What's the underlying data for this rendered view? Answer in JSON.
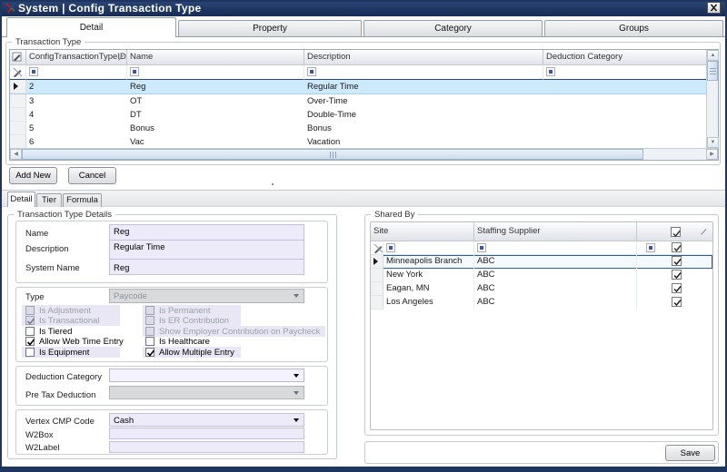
{
  "window": {
    "title": "System | Config Transaction Type"
  },
  "colors": {
    "titlebar": "#1e355f",
    "selection": "#cde9fc",
    "field_lavender": "#edebfa",
    "stripe_lavender": "#e9e7f5"
  },
  "tabs": [
    {
      "label": "Detail",
      "active": true
    },
    {
      "label": "Property",
      "active": false
    },
    {
      "label": "Category",
      "active": false
    },
    {
      "label": "Groups",
      "active": false
    }
  ],
  "transaction_type": {
    "group_label": "Transaction Type",
    "columns": [
      "ConfigTransactionTypeID",
      "Name",
      "Description",
      "Deduction Category"
    ],
    "rows": [
      {
        "id": "2",
        "name": "Reg",
        "description": "Regular Time",
        "deduction_category": "",
        "selected": true
      },
      {
        "id": "3",
        "name": "OT",
        "description": "Over-Time",
        "deduction_category": "",
        "selected": false
      },
      {
        "id": "4",
        "name": "DT",
        "description": "Double-Time",
        "deduction_category": "",
        "selected": false
      },
      {
        "id": "5",
        "name": "Bonus",
        "description": "Bonus",
        "deduction_category": "",
        "selected": false
      },
      {
        "id": "6",
        "name": "Vac",
        "description": "Vacation",
        "deduction_category": "",
        "selected": false
      }
    ]
  },
  "buttons": {
    "add_new": "Add New",
    "cancel": "Cancel",
    "save": "Save"
  },
  "subtabs": [
    {
      "label": "Detail",
      "active": true
    },
    {
      "label": "Tier",
      "active": false
    },
    {
      "label": "Formula",
      "active": false
    }
  ],
  "details": {
    "group_label": "Transaction Type Details",
    "name_label": "Name",
    "name_value": "Reg",
    "description_label": "Description",
    "description_value": "Regular Time",
    "system_name_label": "System Name",
    "system_name_value": "Reg",
    "type_label": "Type",
    "type_value": "Paycode",
    "checkboxes_left": [
      {
        "label": "Is Adjustment",
        "checked": false,
        "disabled": true
      },
      {
        "label": "Is Transactional",
        "checked": true,
        "disabled": true
      },
      {
        "label": "Is Tiered",
        "checked": false,
        "disabled": false
      },
      {
        "label": "Allow Web Time Entry",
        "checked": true,
        "disabled": false
      },
      {
        "label": "Is Equipment",
        "checked": false,
        "disabled": false
      }
    ],
    "checkboxes_right": [
      {
        "label": "Is Permanent",
        "checked": false,
        "disabled": true
      },
      {
        "label": "Is ER Contribution",
        "checked": false,
        "disabled": true
      },
      {
        "label": "Show Employer Contribution on Paycheck",
        "checked": false,
        "disabled": true
      },
      {
        "label": "Is Healthcare",
        "checked": false,
        "disabled": false
      },
      {
        "label": "Allow Multiple Entry",
        "checked": true,
        "disabled": false
      }
    ],
    "deduction_category_label": "Deduction Category",
    "deduction_category_value": "",
    "pre_tax_label": "Pre Tax Deduction",
    "pre_tax_value": "",
    "vertex_label": "Vertex CMP Code",
    "vertex_value": "Cash",
    "w2box_label": "W2Box",
    "w2box_value": "",
    "w2label_label": "W2Label",
    "w2label_value": ""
  },
  "shared_by": {
    "group_label": "Shared By",
    "columns": [
      "Site",
      "Staffing Supplier"
    ],
    "header_checkbox_checked": true,
    "rows": [
      {
        "site": "Minneapolis Branch",
        "supplier": "ABC",
        "checked": true,
        "selected": true
      },
      {
        "site": "New York",
        "supplier": "ABC",
        "checked": true,
        "selected": false
      },
      {
        "site": "Eagan, MN",
        "supplier": "ABC",
        "checked": true,
        "selected": false
      },
      {
        "site": "Los Angeles",
        "supplier": "ABC",
        "checked": true,
        "selected": false
      }
    ]
  }
}
